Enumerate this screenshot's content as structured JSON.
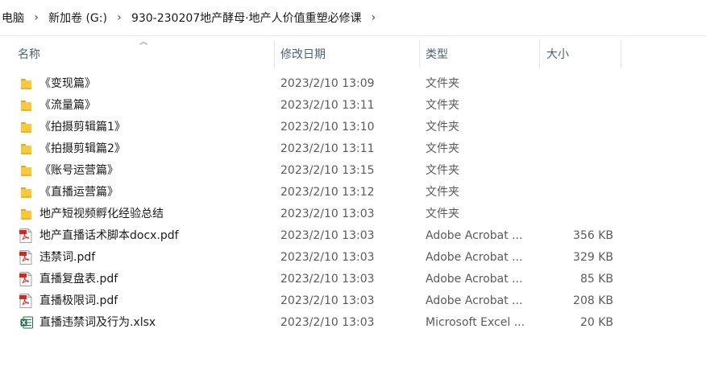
{
  "breadcrumb": {
    "items": [
      "电脑",
      "新加卷 (G:)",
      "930-230207地产酵母·地产人价值重塑必修课"
    ]
  },
  "columns": {
    "name": "名称",
    "date": "修改日期",
    "type": "类型",
    "size": "大小"
  },
  "files": [
    {
      "icon": "folder-icon",
      "name": "《变现篇》",
      "date": "2023/2/10 13:09",
      "type": "文件夹",
      "size": ""
    },
    {
      "icon": "folder-icon",
      "name": "《流量篇》",
      "date": "2023/2/10 13:11",
      "type": "文件夹",
      "size": ""
    },
    {
      "icon": "folder-icon",
      "name": "《拍摄剪辑篇1》",
      "date": "2023/2/10 13:10",
      "type": "文件夹",
      "size": ""
    },
    {
      "icon": "folder-icon",
      "name": "《拍摄剪辑篇2》",
      "date": "2023/2/10 13:11",
      "type": "文件夹",
      "size": ""
    },
    {
      "icon": "folder-icon",
      "name": "《账号运营篇》",
      "date": "2023/2/10 13:15",
      "type": "文件夹",
      "size": ""
    },
    {
      "icon": "folder-icon",
      "name": "《直播运营篇》",
      "date": "2023/2/10 13:12",
      "type": "文件夹",
      "size": ""
    },
    {
      "icon": "folder-icon",
      "name": "地产短视频孵化经验总结",
      "date": "2023/2/10 13:03",
      "type": "文件夹",
      "size": ""
    },
    {
      "icon": "pdf-icon",
      "name": "地产直播话术脚本docx.pdf",
      "date": "2023/2/10 13:03",
      "type": "Adobe Acrobat ...",
      "size": "356 KB"
    },
    {
      "icon": "pdf-icon",
      "name": "违禁词.pdf",
      "date": "2023/2/10 13:03",
      "type": "Adobe Acrobat ...",
      "size": "329 KB"
    },
    {
      "icon": "pdf-icon",
      "name": "直播复盘表.pdf",
      "date": "2023/2/10 13:03",
      "type": "Adobe Acrobat ...",
      "size": "85 KB"
    },
    {
      "icon": "pdf-icon",
      "name": "直播极限词.pdf",
      "date": "2023/2/10 13:03",
      "type": "Adobe Acrobat ...",
      "size": "208 KB"
    },
    {
      "icon": "xlsx-icon",
      "name": "直播违禁词及行为.xlsx",
      "date": "2023/2/10 13:03",
      "type": "Microsoft Excel ...",
      "size": "20 KB"
    }
  ],
  "colors": {
    "folder": "#f8c93c",
    "pdf_red": "#d9261c",
    "excel_green": "#1d7044",
    "header_text": "#4c607a"
  }
}
